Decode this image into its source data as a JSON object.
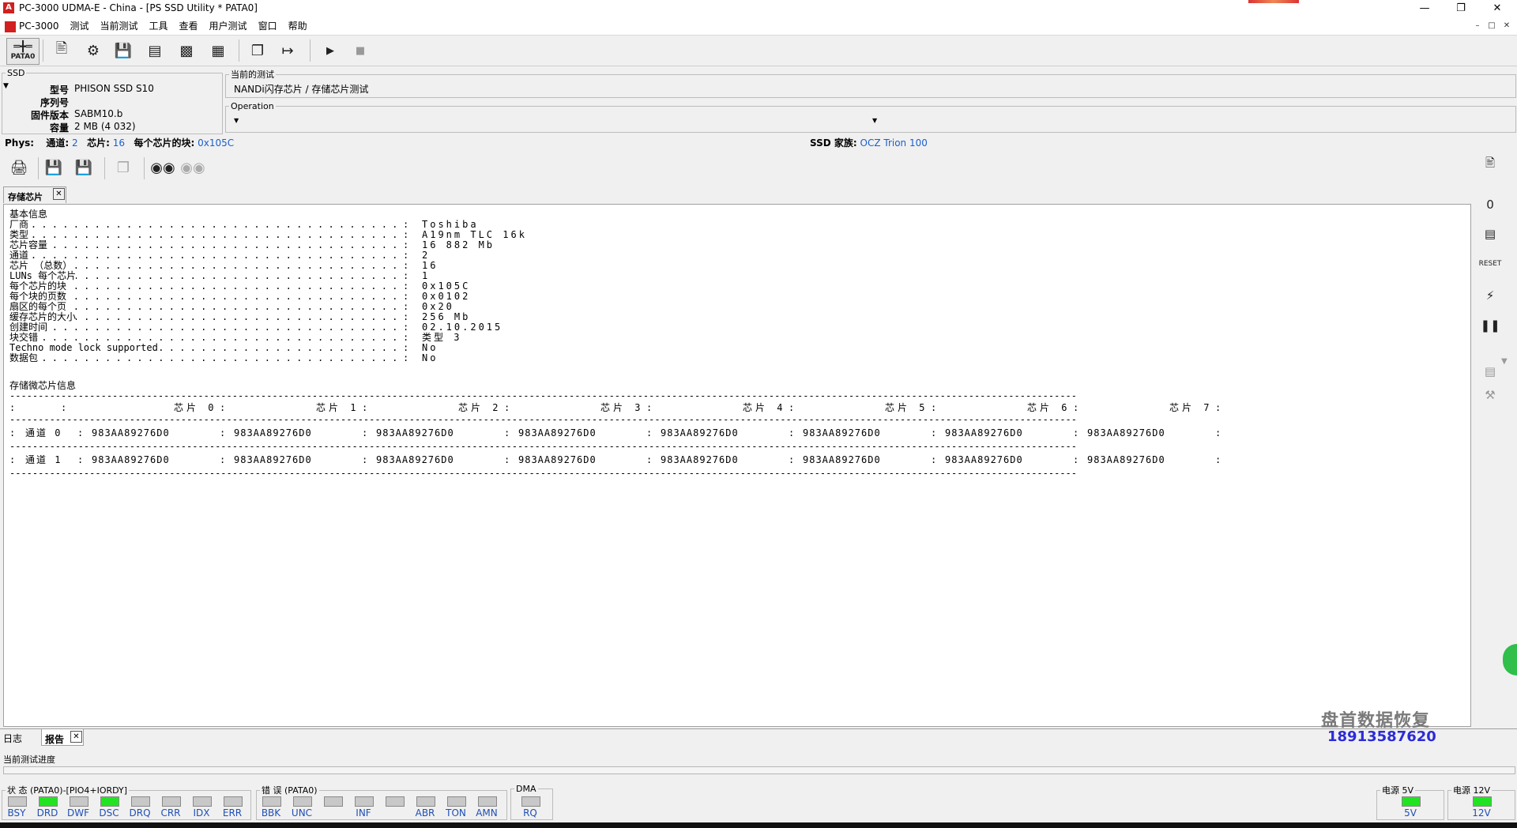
{
  "window": {
    "title": "PC-3000 UDMA-E - China - [PS SSD Utility * PATA0]"
  },
  "menubar": {
    "items": [
      "PC-3000",
      "测试",
      "当前测试",
      "工具",
      "查看",
      "用户测试",
      "窗口",
      "帮助"
    ]
  },
  "toolbar": {
    "pata_label": "PATA0"
  },
  "ssd": {
    "group_label": "SSD",
    "model_label": "型号",
    "model": "PHISON SSD S10",
    "serial_label": "序列号",
    "serial": "",
    "firmware_label": "固件版本",
    "firmware": "SABM10.b",
    "capacity_label": "容量",
    "capacity": "2 MB (4 032)"
  },
  "current_test": {
    "label": "当前的测试",
    "value": "NANDi闪存芯片 / 存储芯片测试"
  },
  "operation": {
    "label": "Operation",
    "value": ""
  },
  "phys": {
    "label": "Phys:",
    "channels_label": "通道:",
    "channels": "2",
    "chips_label": "芯片:",
    "chips": "16",
    "blocks_label": "每个芯片的块:",
    "blocks": "0x105C",
    "family_label": "SSD 家族:",
    "family": "OCZ Trion 100"
  },
  "panel": {
    "tab_label": "存储芯片",
    "basic_title": "基本信息",
    "basic_rows": [
      {
        "key": "厂商",
        "value": "Toshiba"
      },
      {
        "key": "类型",
        "value": "A19nm TLC 16k"
      },
      {
        "key": "芯片容量",
        "value": "16 882 Mb"
      },
      {
        "key": "通道",
        "value": "2"
      },
      {
        "key": "芯片 （总数）",
        "value": "16"
      },
      {
        "key": "LUNs 每个芯片",
        "value": "1"
      },
      {
        "key": "每个芯片的块",
        "value": "0x105C"
      },
      {
        "key": "每个块的页数",
        "value": "0x0102"
      },
      {
        "key": "扇区的每个页",
        "value": "0x20"
      },
      {
        "key": "缓存芯片的大小",
        "value": "256 Mb"
      },
      {
        "key": "创建时间",
        "value": "02.10.2015"
      },
      {
        "key": "块交错",
        "value": "类型 3"
      },
      {
        "key": "Techno mode lock supported",
        "value": "No"
      },
      {
        "key": "数据包",
        "value": "No"
      }
    ],
    "chip_title": "存储微芯片信息",
    "chip_headers": [
      "芯片 0",
      "芯片 1",
      "芯片 2",
      "芯片 3",
      "芯片 4",
      "芯片 5",
      "芯片 6",
      "芯片 7"
    ],
    "chip_rows": [
      {
        "channel": "通道 0",
        "ids": [
          "983AA89276D0",
          "983AA89276D0",
          "983AA89276D0",
          "983AA89276D0",
          "983AA89276D0",
          "983AA89276D0",
          "983AA89276D0",
          "983AA89276D0"
        ]
      },
      {
        "channel": "通道 1",
        "ids": [
          "983AA89276D0",
          "983AA89276D0",
          "983AA89276D0",
          "983AA89276D0",
          "983AA89276D0",
          "983AA89276D0",
          "983AA89276D0",
          "983AA89276D0"
        ]
      }
    ]
  },
  "watermark": {
    "name": "盘首数据恢复",
    "phone": "18913587620"
  },
  "bottom_tabs": [
    "日志",
    "报告"
  ],
  "progress": {
    "label": "当前测试进度"
  },
  "status": {
    "state_label": "状 态 (PATA0)-[PIO4+IORDY]",
    "state_leds": [
      {
        "name": "BSY",
        "on": false
      },
      {
        "name": "DRD",
        "on": true
      },
      {
        "name": "DWF",
        "on": false
      },
      {
        "name": "DSC",
        "on": true
      },
      {
        "name": "DRQ",
        "on": false
      },
      {
        "name": "CRR",
        "on": false
      },
      {
        "name": "IDX",
        "on": false
      },
      {
        "name": "ERR",
        "on": false
      }
    ],
    "error_label": "错 误 (PATA0)",
    "error_leds": [
      {
        "name": "BBK",
        "on": false
      },
      {
        "name": "UNC",
        "on": false
      },
      {
        "name": "",
        "on": false
      },
      {
        "name": "INF",
        "on": false
      },
      {
        "name": "",
        "on": false
      },
      {
        "name": "ABR",
        "on": false
      },
      {
        "name": "TON",
        "on": false
      },
      {
        "name": "AMN",
        "on": false
      }
    ],
    "dma_label": "DMA",
    "dma_leds": [
      {
        "name": "RQ",
        "on": false
      }
    ],
    "power5_label": "电源 5V",
    "power5_led": "5V",
    "power12_label": "电源 12V",
    "power12_led": "12V"
  },
  "colors": {
    "led_on": "#22e322",
    "led_off": "#c8c8c8",
    "link_blue": "#1a5fd0",
    "watermark_blue": "#2c2cd6"
  }
}
